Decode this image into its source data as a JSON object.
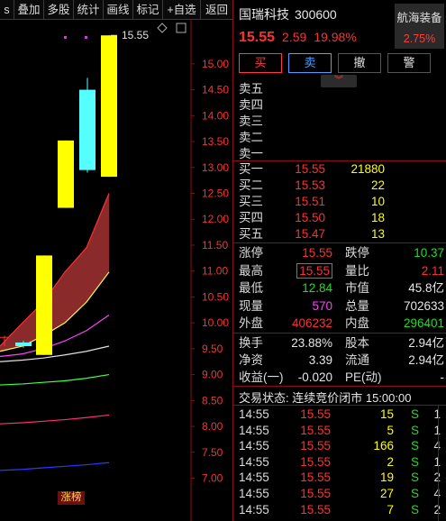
{
  "toolbar": {
    "items": [
      "s",
      "叠加",
      "多股",
      "统计",
      "画线",
      "标记",
      "+自选",
      "返回"
    ]
  },
  "chart": {
    "y_axis_labels": [
      "15.00",
      "14.50",
      "14.00",
      "13.50",
      "13.00",
      "12.50",
      "12.00",
      "11.50",
      "11.00",
      "10.50",
      "10.00",
      "9.50",
      "9.00",
      "8.50",
      "8.00",
      "7.50",
      "7.00"
    ],
    "high_label": "15.55",
    "badge": "涨榜",
    "axis_color": "#ff3030",
    "up_color": "#ffff00",
    "doji_color": "#55ffff",
    "band_color": "#8b2a2a"
  },
  "chart_data": {
    "type": "candlestick",
    "ylim": [
      6.8,
      15.85
    ],
    "candles": [
      {
        "open": 9.55,
        "close": 9.62,
        "high": 9.65,
        "low": 9.52,
        "color": "#55ffff"
      },
      {
        "open": 9.38,
        "close": 11.3,
        "high": 11.3,
        "low": 9.38,
        "color": "#ffff00"
      },
      {
        "open": 12.22,
        "close": 13.52,
        "high": 13.52,
        "low": 12.22,
        "color": "#ffff00"
      },
      {
        "open": 12.95,
        "close": 14.5,
        "high": 14.73,
        "low": 12.9,
        "color": "#55ffff"
      },
      {
        "open": 12.82,
        "close": 15.55,
        "high": 15.55,
        "low": 12.82,
        "color": "#ffff00"
      }
    ],
    "ma_lines": [
      {
        "color": "#ff3030",
        "values": [
          9.55,
          10.0,
          10.4,
          10.98,
          11.45,
          12.5
        ]
      },
      {
        "color": "#ffff44",
        "values": [
          9.45,
          9.55,
          9.75,
          10.0,
          10.4,
          10.98
        ]
      },
      {
        "color": "#ff40ff",
        "values": [
          9.35,
          9.4,
          9.5,
          9.65,
          9.85,
          10.15
        ]
      },
      {
        "color": "#e0e0e0",
        "values": [
          9.25,
          9.28,
          9.32,
          9.38,
          9.45,
          9.55
        ]
      },
      {
        "color": "#44ff44",
        "values": [
          8.8,
          8.82,
          8.85,
          8.88,
          8.93,
          9.0
        ]
      },
      {
        "color": "#ff3070",
        "values": [
          8.05,
          8.07,
          8.1,
          8.13,
          8.17,
          8.22
        ]
      },
      {
        "color": "#2a3aff",
        "values": [
          7.15,
          7.17,
          7.2,
          7.23,
          7.26,
          7.3
        ]
      }
    ]
  },
  "quote": {
    "name": "国瑞科技",
    "code": "300600",
    "price": "15.55",
    "change": "2.59",
    "pct": "19.98%",
    "related_name": "航海装备",
    "related_pct": "2.75%"
  },
  "buttons": {
    "buy": "买",
    "sell": "卖",
    "cancel": "撤",
    "alarm": "警"
  },
  "asks": [
    {
      "label": "卖五",
      "price": "",
      "vol": ""
    },
    {
      "label": "卖四",
      "price": "",
      "vol": ""
    },
    {
      "label": "卖三",
      "price": "",
      "vol": ""
    },
    {
      "label": "卖二",
      "price": "",
      "vol": ""
    },
    {
      "label": "卖一",
      "price": "",
      "vol": ""
    }
  ],
  "bids": [
    {
      "label": "买一",
      "price": "15.55",
      "vol": "21880"
    },
    {
      "label": "买二",
      "price": "15.53",
      "vol": "22"
    },
    {
      "label": "买三",
      "price": "15.51",
      "vol": "10"
    },
    {
      "label": "买四",
      "price": "15.50",
      "vol": "18"
    },
    {
      "label": "买五",
      "price": "15.47",
      "vol": "13"
    }
  ],
  "stats": {
    "limit_up_k": "涨停",
    "limit_up_v": "15.55",
    "limit_down_k": "跌停",
    "limit_down_v": "10.37",
    "high_k": "最高",
    "high_v": "15.55",
    "ratio_k": "量比",
    "ratio_v": "2.11",
    "low_k": "最低",
    "low_v": "12.84",
    "mcap_k": "市值",
    "mcap_v": "45.8亿",
    "cur_k": "现量",
    "cur_v": "570",
    "total_k": "总量",
    "total_v": "702633",
    "out_k": "外盘",
    "out_v": "406232",
    "in_k": "内盘",
    "in_v": "296401"
  },
  "stats2": {
    "turn_k": "换手",
    "turn_v": "23.88%",
    "cap_k": "股本",
    "cap_v": "2.94亿",
    "nav_k": "净资",
    "nav_v": "3.39",
    "float_k": "流通",
    "float_v": "2.94亿",
    "eps_k": "收益(一)",
    "eps_v": "-0.020",
    "pe_k": "PE(动)",
    "pe_v": "-"
  },
  "status": "交易状态: 连续竞价闭市 15:00:00",
  "ticks": [
    {
      "time": "14:55",
      "price": "15.55",
      "qty": "15",
      "side": "S",
      "num": "1"
    },
    {
      "time": "14:55",
      "price": "15.55",
      "qty": "5",
      "side": "S",
      "num": "1"
    },
    {
      "time": "14:55",
      "price": "15.55",
      "qty": "166",
      "side": "S",
      "num": "4"
    },
    {
      "time": "14:55",
      "price": "15.55",
      "qty": "2",
      "side": "S",
      "num": "1"
    },
    {
      "time": "14:55",
      "price": "15.55",
      "qty": "19",
      "side": "S",
      "num": "2"
    },
    {
      "time": "14:55",
      "price": "15.55",
      "qty": "27",
      "side": "S",
      "num": "4"
    },
    {
      "time": "14:55",
      "price": "15.55",
      "qty": "7",
      "side": "S",
      "num": "2"
    }
  ]
}
